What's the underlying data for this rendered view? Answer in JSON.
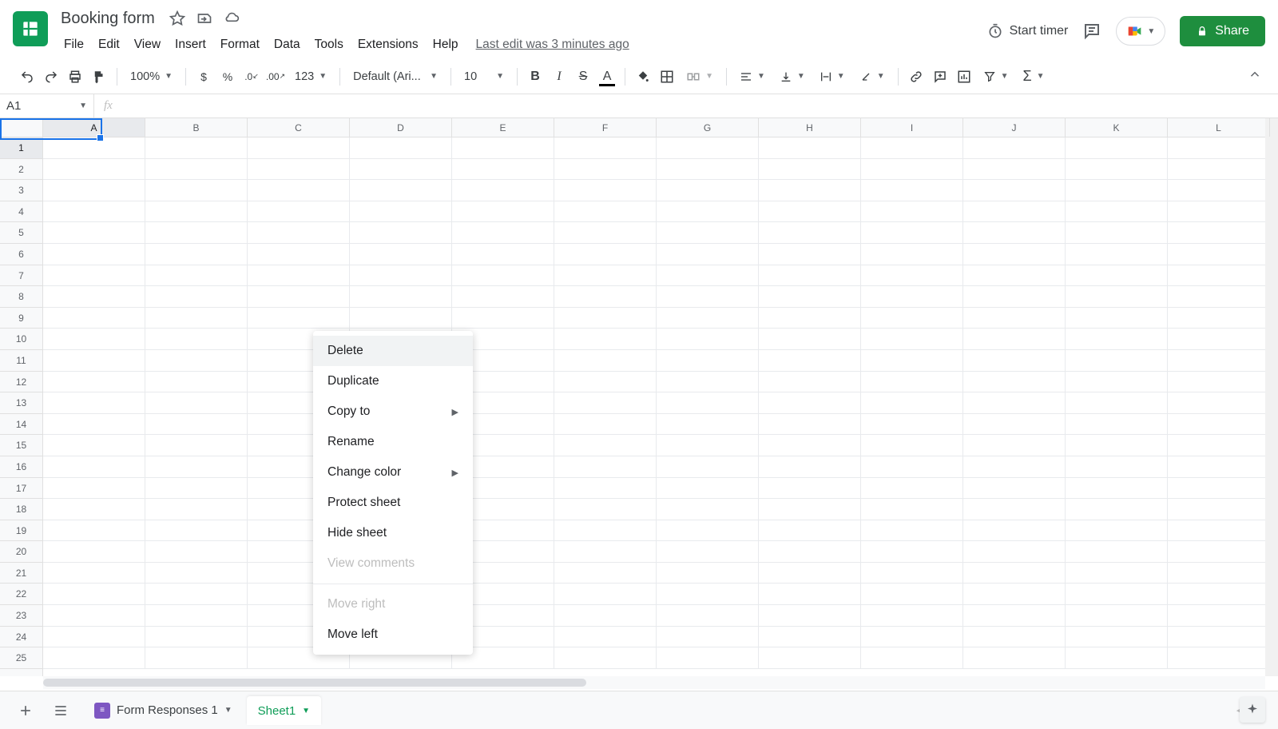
{
  "header": {
    "title": "Booking form",
    "menus": [
      "File",
      "Edit",
      "View",
      "Insert",
      "Format",
      "Data",
      "Tools",
      "Extensions",
      "Help"
    ],
    "last_edit": "Last edit was 3 minutes ago",
    "start_timer": "Start timer",
    "share": "Share"
  },
  "toolbar": {
    "zoom": "100%",
    "currency": "$",
    "percent": "%",
    "dec_dec": ".0",
    "inc_dec": ".00",
    "num_format": "123",
    "font": "Default (Ari...",
    "font_size": "10",
    "bold": "B",
    "italic": "I",
    "strike": "S",
    "text_color": "A",
    "sigma": "Σ"
  },
  "formula_bar": {
    "name_box": "A1",
    "fx": "fx"
  },
  "grid": {
    "columns": [
      "A",
      "B",
      "C",
      "D",
      "E",
      "F",
      "G",
      "H",
      "I",
      "J",
      "K",
      "L"
    ],
    "rows": 25,
    "selected_cell": "A1"
  },
  "context_menu": {
    "items": [
      {
        "label": "Delete",
        "hover": true
      },
      {
        "label": "Duplicate"
      },
      {
        "label": "Copy to",
        "submenu": true
      },
      {
        "label": "Rename"
      },
      {
        "label": "Change color",
        "submenu": true
      },
      {
        "label": "Protect sheet"
      },
      {
        "label": "Hide sheet"
      },
      {
        "label": "View comments",
        "disabled": true
      },
      {
        "sep": true
      },
      {
        "label": "Move right",
        "disabled": true
      },
      {
        "label": "Move left"
      }
    ]
  },
  "sheet_bar": {
    "tabs": [
      {
        "label": "Form Responses 1",
        "form": true,
        "active": false
      },
      {
        "label": "Sheet1",
        "active": true
      }
    ]
  }
}
